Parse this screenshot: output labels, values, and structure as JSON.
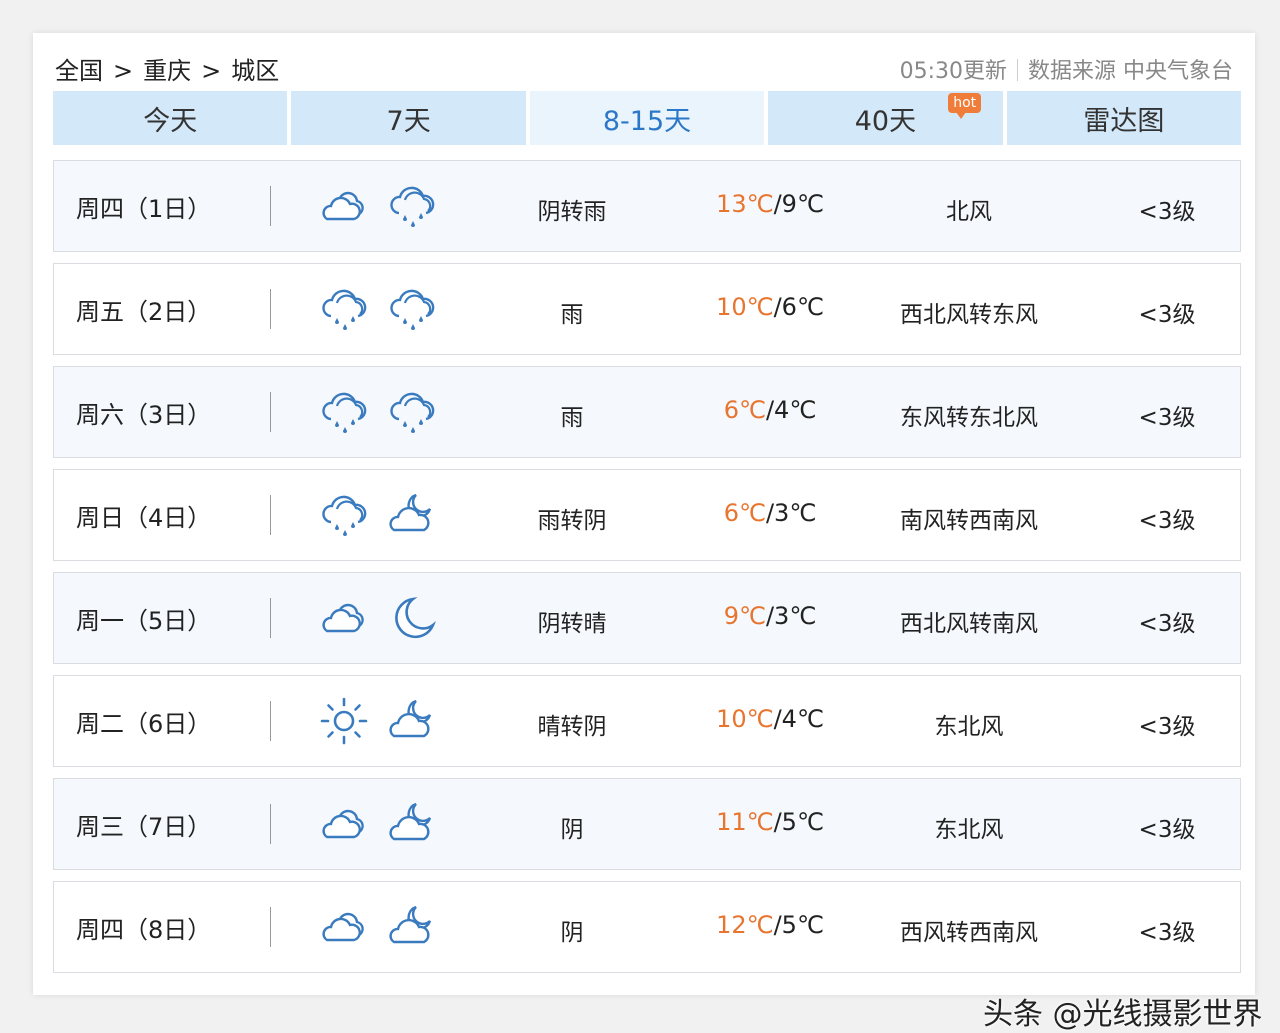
{
  "breadcrumb": {
    "level1": "全国",
    "level2": "重庆",
    "level3": "城区",
    "separator": ">"
  },
  "meta": {
    "updated": "05:30更新",
    "source": "数据来源 中央气象台"
  },
  "tabs": [
    {
      "label": "今天"
    },
    {
      "label": "7天"
    },
    {
      "label": "8-15天",
      "active": true
    },
    {
      "label": "40天",
      "badge": "hot"
    },
    {
      "label": "雷达图"
    }
  ],
  "colors": {
    "tab_bg": "#d3e8f8",
    "tab_active_text": "#2c78c8",
    "high_temp": "#e8752f",
    "icon_blue": "#3a7bbf"
  },
  "forecast": [
    {
      "day": "周四（1日）",
      "icons": [
        "cloudy-icon",
        "rain-icon"
      ],
      "desc": "阴转雨",
      "high": "13℃",
      "low": "9℃",
      "wind": "北风",
      "level": "<3级"
    },
    {
      "day": "周五（2日）",
      "icons": [
        "rain-icon",
        "rain-icon"
      ],
      "desc": "雨",
      "high": "10℃",
      "low": "6℃",
      "wind": "西北风转东风",
      "level": "<3级"
    },
    {
      "day": "周六（3日）",
      "icons": [
        "rain-icon",
        "rain-icon"
      ],
      "desc": "雨",
      "high": "6℃",
      "low": "4℃",
      "wind": "东风转东北风",
      "level": "<3级"
    },
    {
      "day": "周日（4日）",
      "icons": [
        "rain-icon",
        "partly-cloudy-night-icon"
      ],
      "desc": "雨转阴",
      "high": "6℃",
      "low": "3℃",
      "wind": "南风转西南风",
      "level": "<3级"
    },
    {
      "day": "周一（5日）",
      "icons": [
        "cloudy-icon",
        "moon-icon"
      ],
      "desc": "阴转晴",
      "high": "9℃",
      "low": "3℃",
      "wind": "西北风转南风",
      "level": "<3级"
    },
    {
      "day": "周二（6日）",
      "icons": [
        "sun-icon",
        "partly-cloudy-night-icon"
      ],
      "desc": "晴转阴",
      "high": "10℃",
      "low": "4℃",
      "wind": "东北风",
      "level": "<3级"
    },
    {
      "day": "周三（7日）",
      "icons": [
        "cloudy-icon",
        "partly-cloudy-night-icon"
      ],
      "desc": "阴",
      "high": "11℃",
      "low": "5℃",
      "wind": "东北风",
      "level": "<3级"
    },
    {
      "day": "周四（8日）",
      "icons": [
        "cloudy-icon",
        "partly-cloudy-night-icon"
      ],
      "desc": "阴",
      "high": "12℃",
      "low": "5℃",
      "wind": "西风转西南风",
      "level": "<3级"
    }
  ],
  "watermark": "头条 @光线摄影世界"
}
